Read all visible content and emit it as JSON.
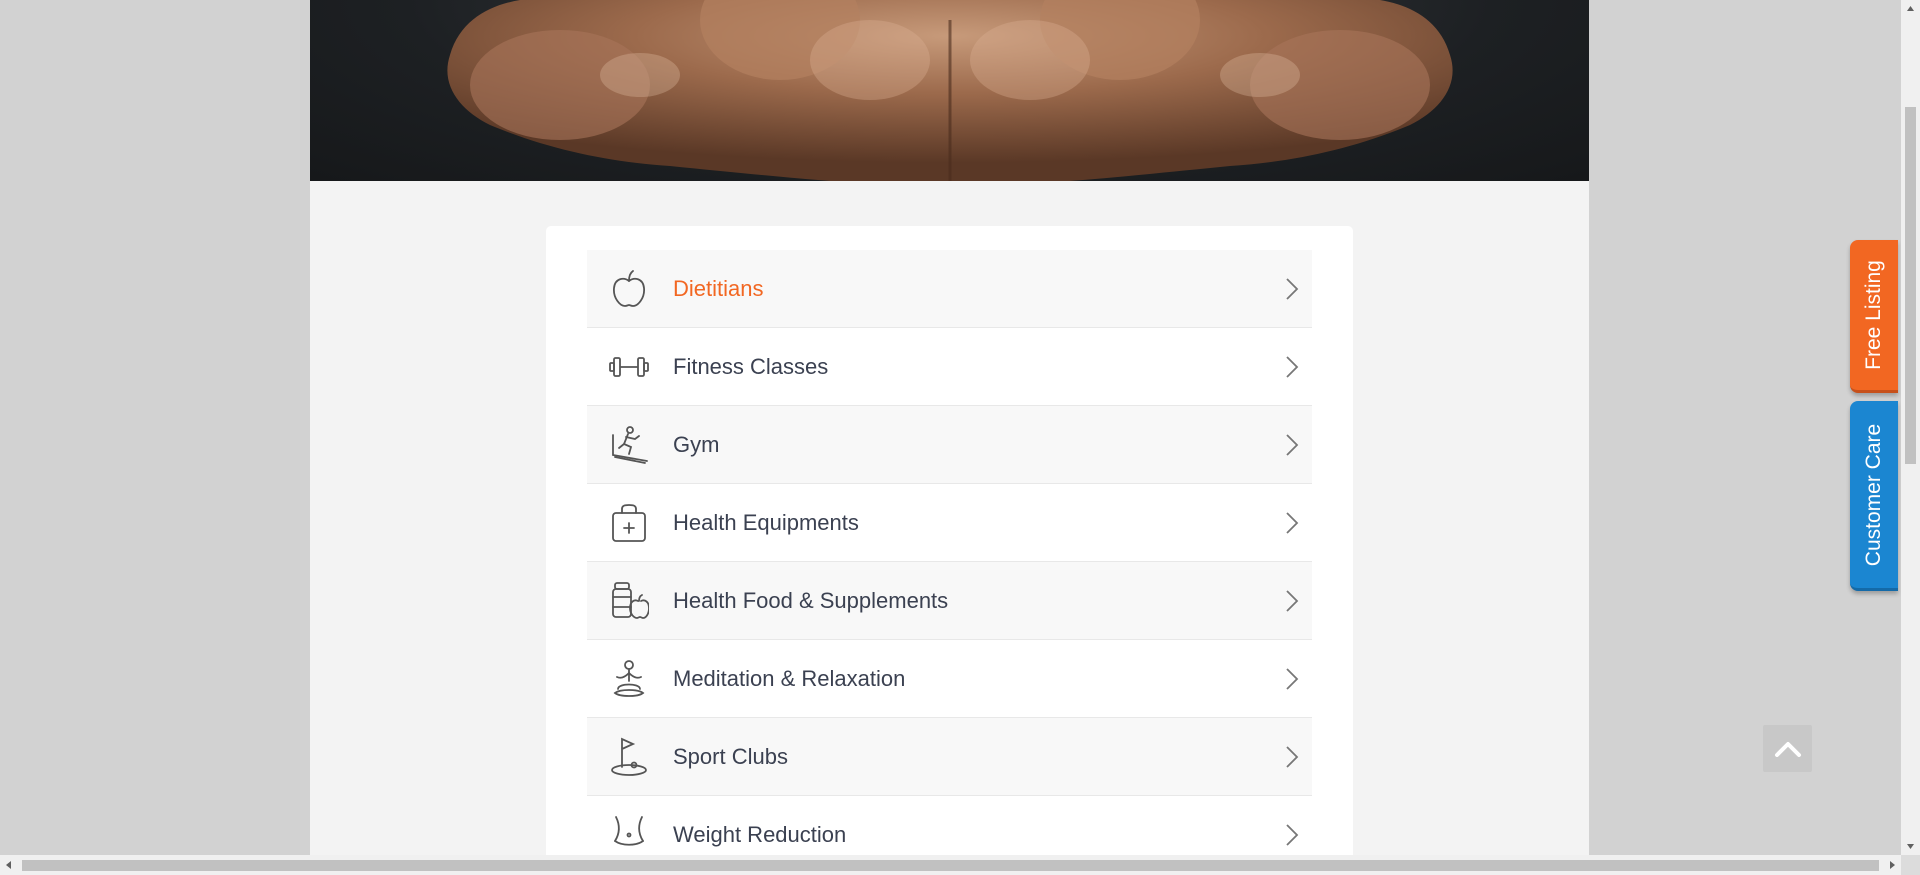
{
  "categories": [
    {
      "label": "Dietitians",
      "icon": "apple-icon",
      "active": true
    },
    {
      "label": "Fitness Classes",
      "icon": "dumbbell-icon",
      "active": false
    },
    {
      "label": "Gym",
      "icon": "treadmill-runner-icon",
      "active": false
    },
    {
      "label": "Health Equipments",
      "icon": "medical-bag-icon",
      "active": false
    },
    {
      "label": "Health Food & Supplements",
      "icon": "supplements-icon",
      "active": false
    },
    {
      "label": "Meditation & Relaxation",
      "icon": "meditation-icon",
      "active": false
    },
    {
      "label": "Sport Clubs",
      "icon": "golf-flag-icon",
      "active": false
    },
    {
      "label": "Weight Reduction",
      "icon": "waist-icon",
      "active": false
    }
  ],
  "side_tabs": {
    "free_listing": "Free Listing",
    "customer_care": "Customer Care"
  },
  "colors": {
    "accent_orange": "#f26722",
    "accent_blue": "#1b86d1",
    "label_text": "#3b4151"
  }
}
